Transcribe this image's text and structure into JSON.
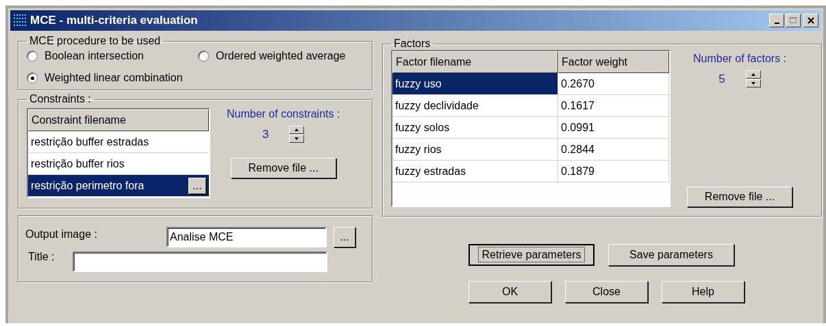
{
  "window": {
    "title": "MCE - multi-criteria evaluation"
  },
  "procedure": {
    "legend": "MCE procedure to be used",
    "options": [
      {
        "label": "Boolean intersection",
        "selected": false
      },
      {
        "label": "Ordered weighted average",
        "selected": false
      },
      {
        "label": "Weighted linear combination",
        "selected": true
      }
    ]
  },
  "constraints": {
    "legend": "Constraints :",
    "column": "Constraint filename",
    "rows": [
      {
        "name": "restrição buffer estradas",
        "selected": false
      },
      {
        "name": "restrição buffer rios",
        "selected": false
      },
      {
        "name": "restrição perimetro fora",
        "selected": true,
        "browse": "..."
      }
    ],
    "count_label": "Number of constraints :",
    "count": "3",
    "remove_button": "Remove file ..."
  },
  "output": {
    "image_label": "Output image :",
    "image_value": "Analise MCE",
    "browse": "...",
    "title_label": "Title :"
  },
  "factors": {
    "legend": "Factors",
    "columns": [
      "Factor filename",
      "Factor weight"
    ],
    "rows": [
      {
        "name": "fuzzy uso",
        "weight": "0.2670",
        "selected": true
      },
      {
        "name": "fuzzy declividade",
        "weight": "0.1617",
        "selected": false
      },
      {
        "name": "fuzzy solos",
        "weight": "0.0991",
        "selected": false
      },
      {
        "name": "fuzzy rios",
        "weight": "0.2844",
        "selected": false
      },
      {
        "name": "fuzzy estradas",
        "weight": "0.1879",
        "selected": false
      }
    ],
    "count_label": "Number of factors :",
    "count": "5",
    "remove_button": "Remove file ..."
  },
  "parameter_buttons": [
    {
      "label": "Retrieve parameters",
      "focused": true
    },
    {
      "label": "Save parameters",
      "focused": false
    }
  ],
  "dialog_buttons": [
    "OK",
    "Close",
    "Help"
  ]
}
